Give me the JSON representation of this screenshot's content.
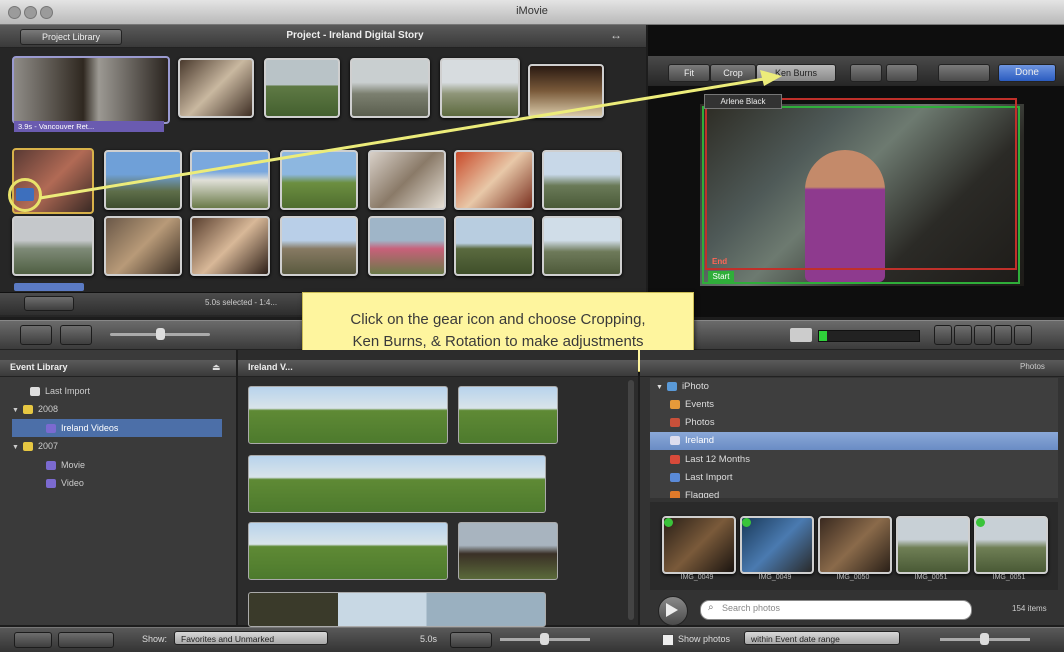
{
  "window": {
    "title": "iMovie"
  },
  "project_pane": {
    "library_button": "Project Library",
    "title": "Project - Ireland Digital Story",
    "expand_glyph": "↔",
    "clip_badge": "3.9s - Vancouver Ret...",
    "status": "5.0s selected - 1:4..."
  },
  "viewer": {
    "toolbar": {
      "fit": "Fit",
      "crop": "Crop",
      "ken_burns": "Ken Burns",
      "done": "Done"
    },
    "title_tag": "Arlene Black",
    "end_label": "End",
    "start_label": "Start"
  },
  "callout": {
    "line1": "Click on the gear icon and choose Cropping,",
    "line2": "Ken Burns, & Rotation to make adjustments"
  },
  "event_library": {
    "header": "Event Library",
    "items": [
      {
        "label": "Last Import",
        "indent": 1
      },
      {
        "label": "2008",
        "indent": 0
      },
      {
        "label": "Ireland Videos",
        "indent": 1,
        "selected": true
      },
      {
        "label": "2007",
        "indent": 0
      },
      {
        "label": "Movie",
        "indent": 1
      },
      {
        "label": "Video",
        "indent": 1
      }
    ]
  },
  "event_browser": {
    "header": "Ireland V..."
  },
  "photo_browser": {
    "header": "Photos",
    "sources": [
      {
        "label": "iPhoto",
        "icon": "iphoto-icon"
      },
      {
        "label": "Events",
        "icon": "events-icon"
      },
      {
        "label": "Photos",
        "icon": "photos-icon"
      },
      {
        "label": "Ireland",
        "icon": "album-icon",
        "selected": true
      },
      {
        "label": "Last 12 Months",
        "icon": "calendar-icon"
      },
      {
        "label": "Last Import",
        "icon": "import-icon"
      },
      {
        "label": "Flagged",
        "icon": "flag-icon"
      }
    ],
    "photos": [
      {
        "name": "IMG_0049"
      },
      {
        "name": "IMG_0049"
      },
      {
        "name": "IMG_0050"
      },
      {
        "name": "IMG_0051"
      },
      {
        "name": "IMG_0051"
      }
    ],
    "search_placeholder": "Search photos",
    "count": "154 items"
  },
  "bottom_bar": {
    "show_label": "Show:",
    "show_value": "Favorites and Unmarked",
    "duration": "5.0s",
    "show_photos": "Show photos",
    "photo_range": "within Event date range"
  },
  "colors": {
    "callout_bg": "#fef59e",
    "selection_blue": "#4c6fa8",
    "clip_purple": "#6a5bb0",
    "arrow": "#ecec7a"
  }
}
